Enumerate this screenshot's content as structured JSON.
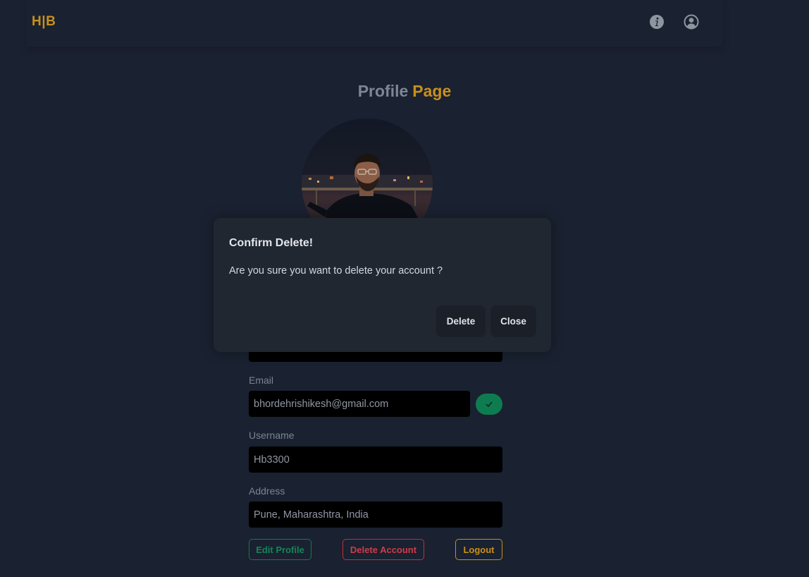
{
  "navbar": {
    "brand_h": "H",
    "brand_sep": "|",
    "brand_b": "B",
    "info_icon": "info-icon",
    "user_icon": "user-circle-icon"
  },
  "profile": {
    "title_part1": "Profile",
    "title_part2": "Page",
    "avatar": "profile-avatar-photo"
  },
  "form": {
    "email_label": "Email",
    "email_value": "bhordehrishikesh@gmail.com",
    "username_label": "Username",
    "username_value": "Hb3300",
    "address_label": "Address",
    "address_value": "Pune, Maharashtra, India"
  },
  "actions": {
    "edit_label": "Edit Profile",
    "delete_label": "Delete Account",
    "logout_label": "Logout"
  },
  "modal": {
    "title": "Confirm Delete!",
    "body": "Are you sure you want to delete your account ?",
    "delete_label": "Delete",
    "close_label": "Close"
  },
  "colors": {
    "accent": "#c8901a",
    "success": "#0d7d51",
    "danger": "#cf3c47",
    "background": "#1a2130"
  }
}
